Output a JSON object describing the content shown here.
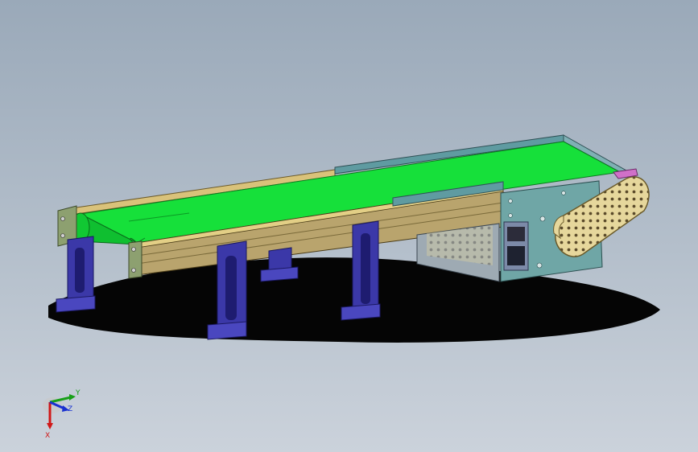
{
  "viewport": {
    "background_top": "#9aa9b9",
    "background_bottom": "#cbd2db"
  },
  "model": {
    "belt_color": "#16e03a",
    "frame_color": "#b9a46d",
    "leg_color": "#3b38a8",
    "motor_box_color": "#6fa6a6",
    "chain_cover_color": "#e6d79c"
  },
  "triad": {
    "x_label": "X",
    "y_label": "Y",
    "z_label": "Z",
    "x_color": "#d01818",
    "y_color": "#18a018",
    "z_color": "#1830d0"
  }
}
